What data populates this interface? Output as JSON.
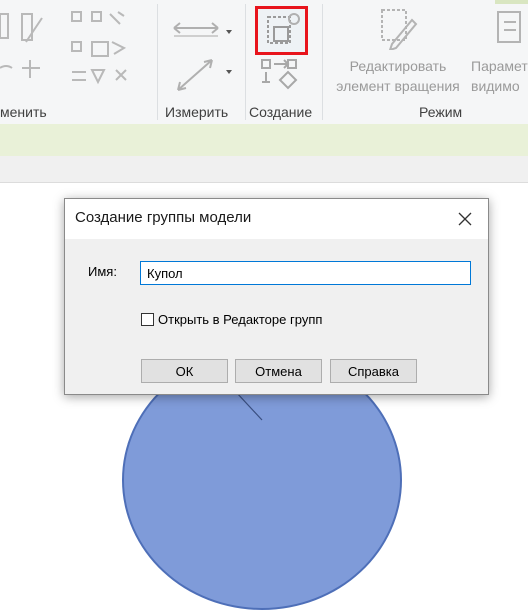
{
  "ribbon": {
    "panels": [
      {
        "label": "менить"
      },
      {
        "label": "Измерить"
      },
      {
        "label": "Создание"
      },
      {
        "label": "Режим"
      }
    ],
    "edit_rotation_button": {
      "line1": "Редактировать",
      "line2": "элемент вращения"
    },
    "parameters_button": {
      "line1": "Парамет",
      "line2": "видимо"
    },
    "create_group_icon": "create-group-icon"
  },
  "dialog": {
    "title": "Создание группы модели",
    "name_label": "Имя:",
    "name_value": "Купол",
    "checkbox_label": "Открыть в Редакторе групп",
    "checkbox_checked": false,
    "buttons": {
      "ok": "ОК",
      "cancel": "Отмена",
      "help": "Справка"
    }
  },
  "colors": {
    "highlight": "#e8141c",
    "ribbon_strip": "#e9f1d8",
    "dome_fill": "#7f9bd9",
    "input_border": "#0078d7"
  }
}
